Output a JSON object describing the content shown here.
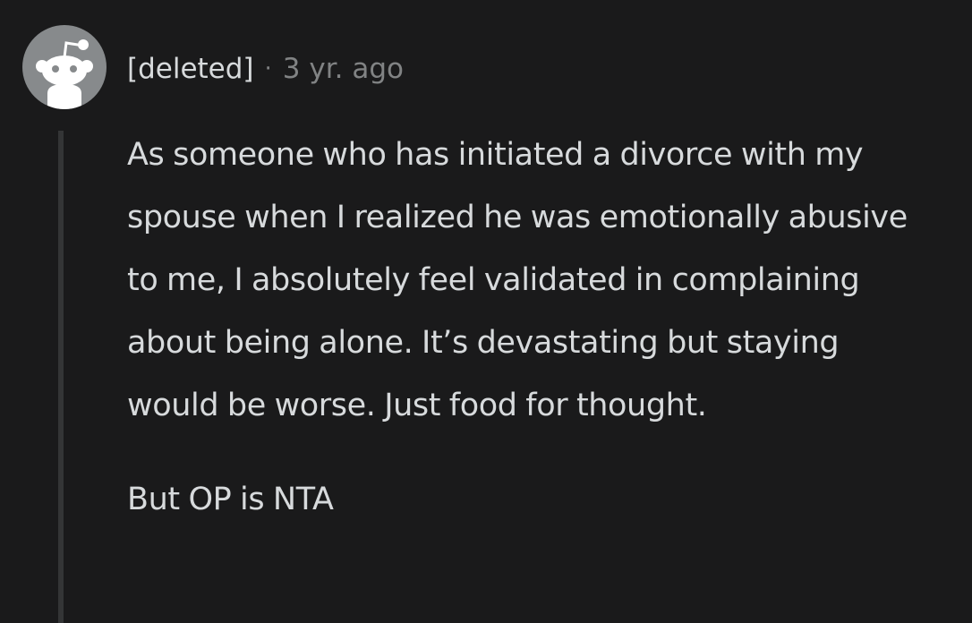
{
  "comment": {
    "author": "[deleted]",
    "separator": "·",
    "timestamp": "3 yr. ago",
    "avatar_icon": "snoo-avatar-icon",
    "paragraphs": [
      "As someone who has initiated a divorce with my spouse when I realized he was emotionally abusive to me, I absolutely feel validated in complaining about being alone. It’s devastating but staying would be worse. Just food for thought.",
      "But OP is NTA"
    ]
  },
  "colors": {
    "background": "#1a1a1b",
    "text": "#d7dadc",
    "muted": "#818384",
    "avatar_bg": "#878a8c",
    "thread_line": "#343536"
  }
}
